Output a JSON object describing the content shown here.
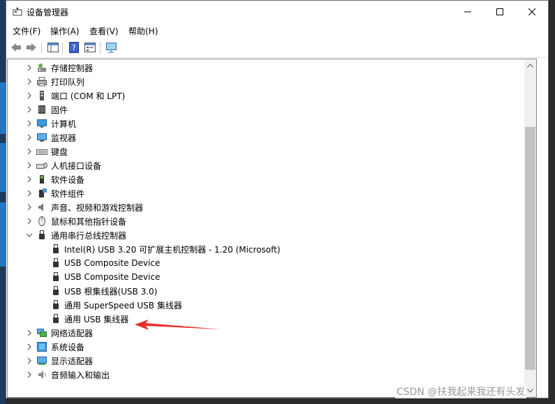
{
  "window": {
    "title": "设备管理器"
  },
  "menu": [
    "文件(F)",
    "操作(A)",
    "查看(V)",
    "帮助(H)"
  ],
  "toolbar": {
    "buttons": [
      "back-icon",
      "forward-icon",
      "show-hide-console-tree-icon",
      "help-icon",
      "properties-icon",
      "scan-hardware-icon"
    ]
  },
  "tree": {
    "categories_top": [
      {
        "label": "存储控制器",
        "icon": "storage-controller-icon"
      },
      {
        "label": "打印队列",
        "icon": "printer-icon"
      },
      {
        "label": "端口 (COM 和 LPT)",
        "icon": "port-icon"
      },
      {
        "label": "固件",
        "icon": "firmware-icon"
      },
      {
        "label": "计算机",
        "icon": "computer-icon"
      },
      {
        "label": "监视器",
        "icon": "monitor-icon"
      },
      {
        "label": "键盘",
        "icon": "keyboard-icon"
      },
      {
        "label": "人机接口设备",
        "icon": "hid-icon"
      },
      {
        "label": "软件设备",
        "icon": "software-device-icon"
      },
      {
        "label": "软件组件",
        "icon": "software-component-icon"
      },
      {
        "label": "声音、视频和游戏控制器",
        "icon": "sound-icon"
      },
      {
        "label": "鼠标和其他指针设备",
        "icon": "mouse-icon"
      }
    ],
    "expanded": {
      "label": "通用串行总线控制器",
      "icon": "usb-controller-icon",
      "children": [
        "Intel(R) USB 3.20 可扩展主机控制器 - 1.20 (Microsoft)",
        "USB Composite Device",
        "USB Composite Device",
        "USB 根集线器(USB 3.0)",
        "通用 SuperSpeed USB 集线器",
        "通用 USB 集线器"
      ]
    },
    "categories_bottom": [
      {
        "label": "网络适配器",
        "icon": "network-adapter-icon"
      },
      {
        "label": "系统设备",
        "icon": "system-device-icon"
      },
      {
        "label": "显示适配器",
        "icon": "display-adapter-icon"
      },
      {
        "label": "音频输入和输出",
        "icon": "audio-io-icon"
      }
    ]
  },
  "annotation": {
    "arrow_color": "#e8302a"
  },
  "watermark": "CSDN @扶我起来我还有头发"
}
